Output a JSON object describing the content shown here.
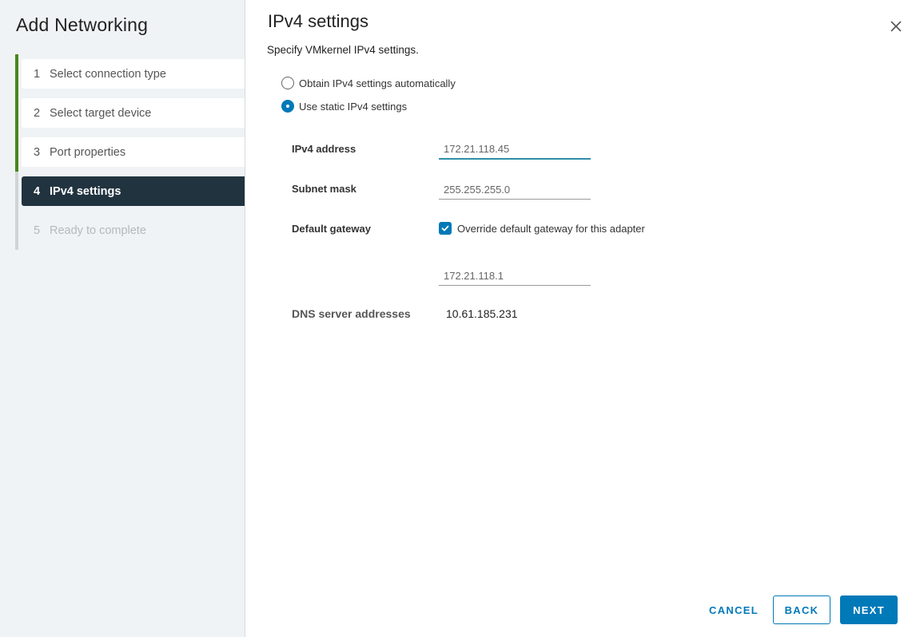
{
  "wizard": {
    "title": "Add Networking",
    "steps": [
      {
        "number": "1",
        "label": "Select connection type",
        "state": "completed"
      },
      {
        "number": "2",
        "label": "Select target device",
        "state": "completed"
      },
      {
        "number": "3",
        "label": "Port properties",
        "state": "completed"
      },
      {
        "number": "4",
        "label": "IPv4 settings",
        "state": "active"
      },
      {
        "number": "5",
        "label": "Ready to complete",
        "state": "disabled"
      }
    ]
  },
  "page": {
    "title": "IPv4 settings",
    "subtitle": "Specify VMkernel IPv4 settings.",
    "close_icon": "close-icon"
  },
  "ipv4_mode": {
    "options": [
      {
        "label": "Obtain IPv4 settings automatically",
        "selected": false
      },
      {
        "label": "Use static IPv4 settings",
        "selected": true
      }
    ]
  },
  "form": {
    "ipv4_address": {
      "label": "IPv4 address",
      "value": "172.21.118.45"
    },
    "subnet_mask": {
      "label": "Subnet mask",
      "value": "255.255.255.0"
    },
    "default_gateway": {
      "label": "Default gateway",
      "override_label": "Override default gateway for this adapter",
      "override_checked": true,
      "value": "172.21.118.1"
    },
    "dns": {
      "label": "DNS server addresses",
      "value": "10.61.185.231"
    }
  },
  "footer": {
    "cancel_label": "CANCEL",
    "back_label": "BACK",
    "next_label": "NEXT"
  },
  "colors": {
    "accent": "#0079b8",
    "progress_complete": "#48871b",
    "active_step_bg": "#21333f"
  }
}
